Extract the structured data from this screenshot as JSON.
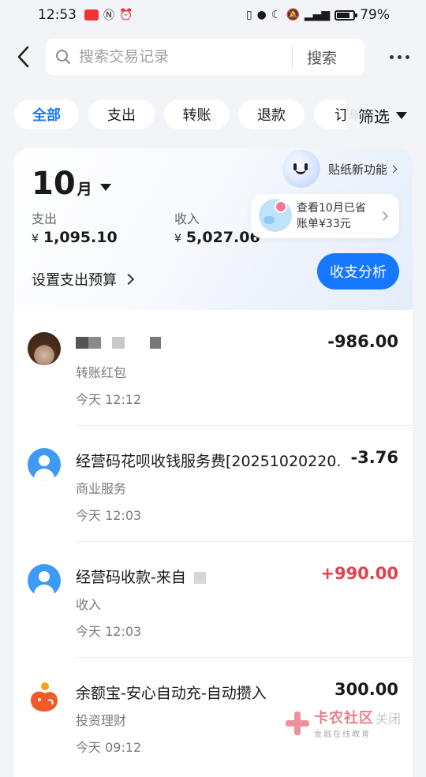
{
  "status_bar": {
    "time": "12:53",
    "battery_percent_label": "79%",
    "battery_level": 0.79,
    "icons": [
      "app-icon",
      "nfc-icon",
      "alarm-icon",
      "vibrate-icon",
      "location-icon",
      "moon-icon",
      "mute-icon",
      "signal-icon",
      "battery-icon"
    ]
  },
  "header": {
    "search_placeholder": "搜索交易记录",
    "search_button": "搜索"
  },
  "filters": {
    "chips": [
      "全部",
      "支出",
      "转账",
      "退款",
      "订单"
    ],
    "active_index": 0,
    "filter_label": "筛选"
  },
  "summary": {
    "month_number": "10",
    "month_unit": "月",
    "expense_label": "支出",
    "expense_currency": "¥",
    "expense_value": "1,095.10",
    "income_label": "收入",
    "income_currency": "¥",
    "income_value": "5,027.06",
    "budget_label": "设置支出预算",
    "sticker_promo": "贴纸新功能",
    "savings_line1": "查看10月已省",
    "savings_line2": "账单¥33元",
    "analysis_button": "收支分析",
    "accent_color": "#1677ff"
  },
  "transactions": [
    {
      "avatar": "photo",
      "title": "",
      "redacted": true,
      "amount": "-986.00",
      "category": "转账红包",
      "time": "今天 12:12",
      "positive": false
    },
    {
      "avatar": "user-icon",
      "title": "经营码花呗收钱服务费[2025102022​0...",
      "redacted": false,
      "amount": "-3.76",
      "category": "商业服务",
      "time": "今天 12:03",
      "positive": false
    },
    {
      "avatar": "user-icon",
      "title": "经营码收款-来自",
      "redacted": true,
      "amount": "+990.00",
      "category": "收入",
      "time": "今天 12:03",
      "positive": true
    },
    {
      "avatar": "yuebao-icon",
      "title": "余额宝-安心自动充-自动攒入",
      "redacted": false,
      "amount": "300.00",
      "category": "投资理财",
      "time": "今天 09:12",
      "positive": false
    }
  ],
  "watermark": {
    "main": "卡农社区",
    "sub": "金融在线教育",
    "close": "关闭"
  },
  "colors": {
    "positive_amount": "#e2414c",
    "brand_blue": "#1677ff"
  }
}
